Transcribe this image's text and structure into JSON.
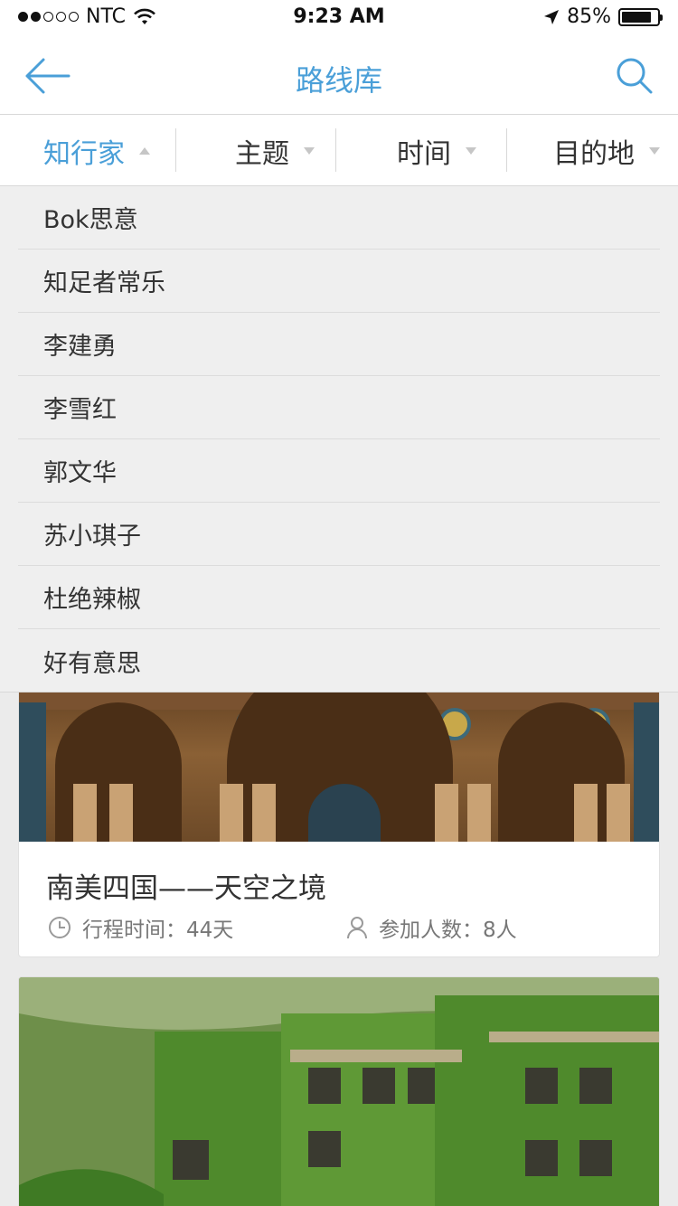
{
  "status_bar": {
    "carrier": "NTC",
    "time": "9:23 AM",
    "battery": "85%",
    "battery_level": 0.85,
    "signal_bars": 2
  },
  "nav": {
    "title": "路线库",
    "back_icon": "arrow-left-icon",
    "search_icon": "search-icon"
  },
  "filters": [
    {
      "label": "知行家",
      "active": true
    },
    {
      "label": "主题",
      "active": false
    },
    {
      "label": "时间",
      "active": false
    },
    {
      "label": "目的地",
      "active": false
    }
  ],
  "dropdown": {
    "items": [
      "Bok思意",
      "知足者常乐",
      "李建勇",
      "李雪红",
      "郭文华",
      "苏小琪子",
      "杜绝辣椒",
      "好有意思"
    ]
  },
  "routes": [
    {
      "title": "南美四国——天空之境",
      "duration": "行程时间：44天",
      "participants": "参加人数：8人"
    }
  ],
  "colors": {
    "accent": "#4a9fd8",
    "background": "#ebebeb"
  }
}
